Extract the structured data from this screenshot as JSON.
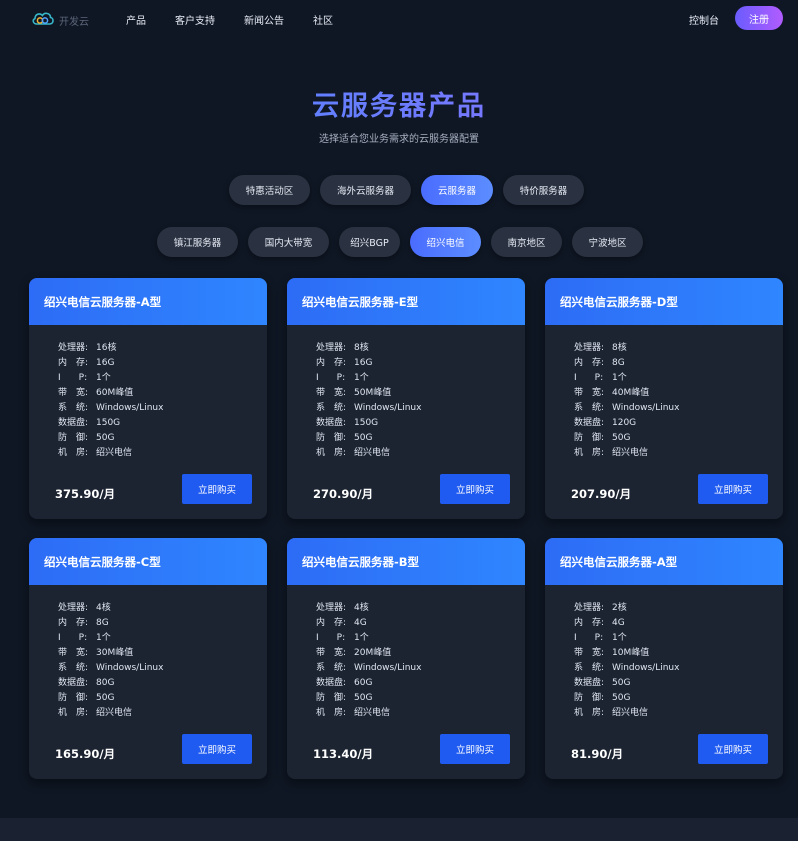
{
  "header": {
    "logo_text": "开发云",
    "nav": [
      "产品",
      "客户支持",
      "新闻公告",
      "社区"
    ],
    "console": "控制台",
    "register": "注册"
  },
  "hero": {
    "title": "云服务器产品",
    "subtitle": "选择适合您业务需求的云服务器配置"
  },
  "categories": [
    "特惠活动区",
    "海外云服务器",
    "云服务器",
    "特价服务器"
  ],
  "regions": [
    "镇江服务器",
    "国内大带宽",
    "绍兴BGP",
    "绍兴电信",
    "南京地区",
    "宁波地区"
  ],
  "active": {
    "category": "云服务器",
    "region": "绍兴电信"
  },
  "spec_labels": [
    "处理器:",
    "内　存:",
    "I　　P:",
    "带　宽:",
    "系　统:",
    "数据盘:",
    "防　御:",
    "机　房:"
  ],
  "buy_label": "立即购买",
  "products": [
    {
      "title": "绍兴电信云服务器-A型",
      "specs": [
        "16核",
        "16G",
        "1个",
        "60M峰值",
        "Windows/Linux",
        "150G",
        "50G",
        "绍兴电信"
      ],
      "price": "375.90/月"
    },
    {
      "title": "绍兴电信云服务器-E型",
      "specs": [
        "8核",
        "16G",
        "1个",
        "50M峰值",
        "Windows/Linux",
        "150G",
        "50G",
        "绍兴电信"
      ],
      "price": "270.90/月"
    },
    {
      "title": "绍兴电信云服务器-D型",
      "specs": [
        "8核",
        "8G",
        "1个",
        "40M峰值",
        "Windows/Linux",
        "120G",
        "50G",
        "绍兴电信"
      ],
      "price": "207.90/月"
    },
    {
      "title": "绍兴电信云服务器-C型",
      "specs": [
        "4核",
        "8G",
        "1个",
        "30M峰值",
        "Windows/Linux",
        "80G",
        "50G",
        "绍兴电信"
      ],
      "price": "165.90/月"
    },
    {
      "title": "绍兴电信云服务器-B型",
      "specs": [
        "4核",
        "4G",
        "1个",
        "20M峰值",
        "Windows/Linux",
        "60G",
        "50G",
        "绍兴电信"
      ],
      "price": "113.40/月"
    },
    {
      "title": "绍兴电信云服务器-A型",
      "specs": [
        "2核",
        "4G",
        "1个",
        "10M峰值",
        "Windows/Linux",
        "50G",
        "50G",
        "绍兴电信"
      ],
      "price": "81.90/月"
    }
  ]
}
